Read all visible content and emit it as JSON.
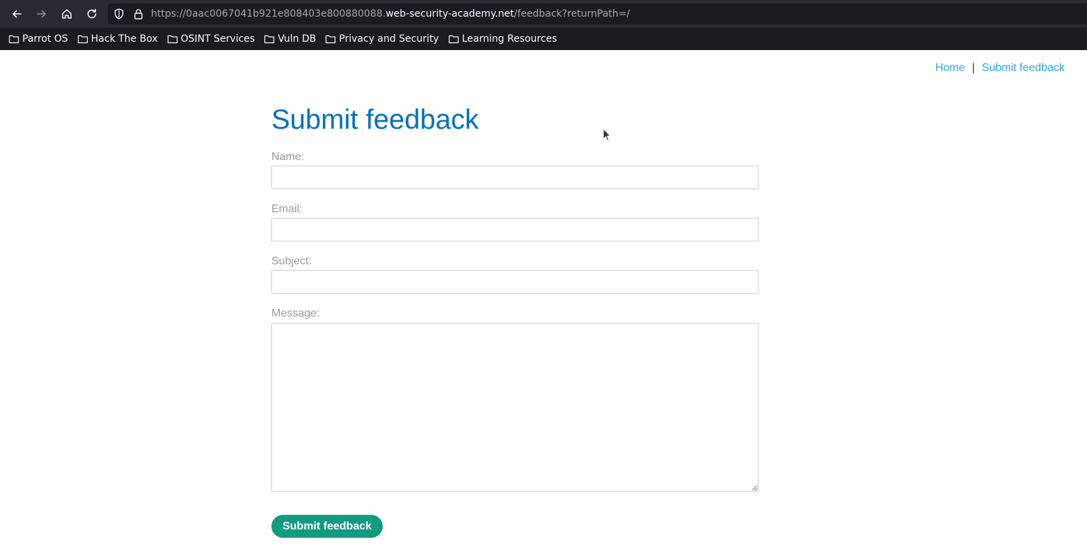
{
  "browser": {
    "url_prefix": "https://0aac0067041b921e808403e800880088.",
    "url_host": "web-security-academy.net",
    "url_path": "/feedback?returnPath=/",
    "bookmarks": [
      {
        "label": "Parrot OS"
      },
      {
        "label": "Hack The Box"
      },
      {
        "label": "OSINT Services"
      },
      {
        "label": "Vuln DB"
      },
      {
        "label": "Privacy and Security"
      },
      {
        "label": "Learning Resources"
      }
    ],
    "icons": [
      "back-arrow-icon",
      "forward-arrow-icon",
      "home-icon",
      "reload-icon",
      "shield-icon",
      "lock-icon",
      "folder-icon"
    ]
  },
  "nav": {
    "home": "Home",
    "separator": "|",
    "submit_feedback": "Submit feedback"
  },
  "page": {
    "title": "Submit feedback"
  },
  "form": {
    "name_label": "Name:",
    "name_value": "",
    "email_label": "Email:",
    "email_value": "",
    "subject_label": "Subject:",
    "subject_value": "",
    "message_label": "Message:",
    "message_value": "",
    "submit_label": "Submit feedback"
  },
  "colors": {
    "title": "#0071bc",
    "link": "#29a8db",
    "button": "#139b7f",
    "label": "#999999",
    "chrome_bg": "#1c1b22",
    "toolbar_bg": "#2b2a33"
  }
}
